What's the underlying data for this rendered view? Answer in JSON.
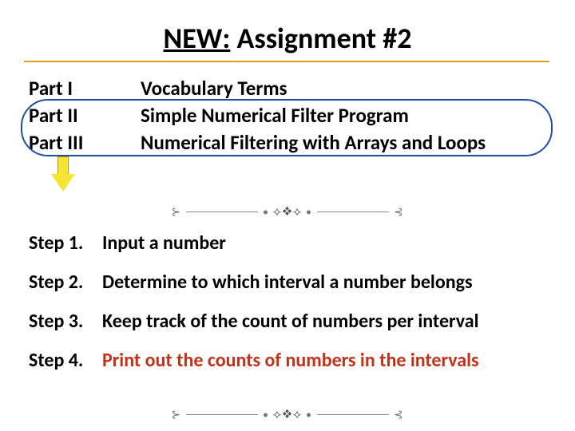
{
  "title": {
    "new": "NEW:",
    "rest": " Assignment #2"
  },
  "parts": [
    {
      "label": "Part I",
      "desc": "Vocabulary Terms"
    },
    {
      "label": "Part II",
      "desc": "Simple Numerical Filter Program"
    },
    {
      "label": "Part III",
      "desc": "Numerical Filtering with Arrays and Loops"
    }
  ],
  "steps": [
    {
      "label": "Step 1.",
      "text": "Input a number",
      "red": false
    },
    {
      "label": "Step 2.",
      "text": "Determine to which interval a number belongs",
      "red": false
    },
    {
      "label": "Step 3.",
      "text": "Keep track of the count of numbers per interval",
      "red": false
    },
    {
      "label": "Step 4.",
      "text": "Print out the counts of numbers in the intervals",
      "red": true
    }
  ]
}
